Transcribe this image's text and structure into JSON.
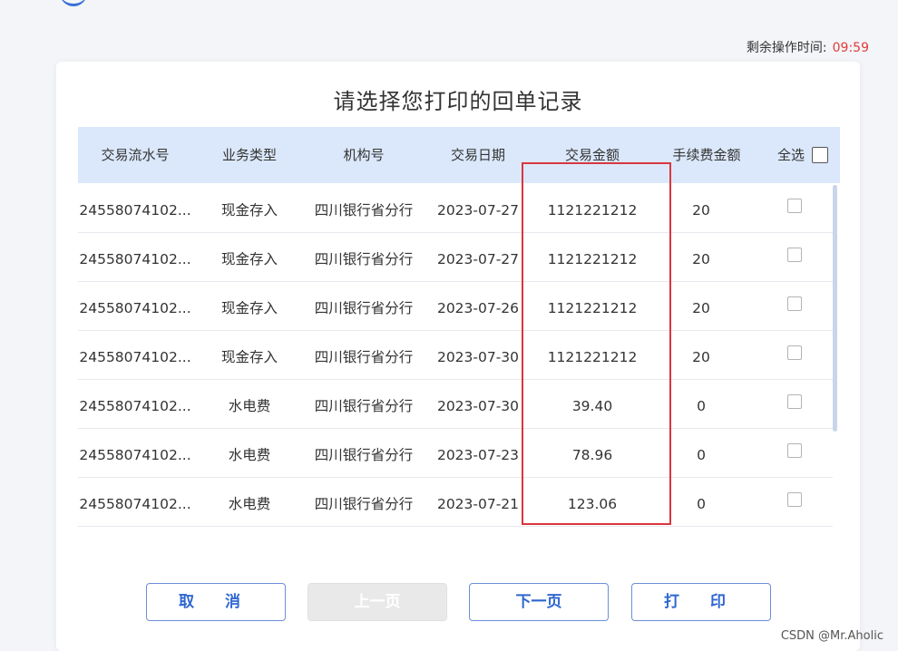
{
  "timer": {
    "label": "剩余操作时间:",
    "value": "09:59"
  },
  "title": "请选择您打印的回单记录",
  "table": {
    "headers": [
      "交易流水号",
      "业务类型",
      "机构号",
      "交易日期",
      "交易金额",
      "手续费金额",
      "全选"
    ],
    "rows": [
      [
        "24558074102...",
        "现金存入",
        "四川银行省分行",
        "2023-07-27",
        "1121221212",
        "20"
      ],
      [
        "24558074102...",
        "现金存入",
        "四川银行省分行",
        "2023-07-27",
        "1121221212",
        "20"
      ],
      [
        "24558074102...",
        "现金存入",
        "四川银行省分行",
        "2023-07-26",
        "1121221212",
        "20"
      ],
      [
        "24558074102...",
        "现金存入",
        "四川银行省分行",
        "2023-07-30",
        "1121221212",
        "20"
      ],
      [
        "24558074102...",
        "水电费",
        "四川银行省分行",
        "2023-07-30",
        "39.40",
        "0"
      ],
      [
        "24558074102...",
        "水电费",
        "四川银行省分行",
        "2023-07-23",
        "78.96",
        "0"
      ],
      [
        "24558074102...",
        "水电费",
        "四川银行省分行",
        "2023-07-21",
        "123.06",
        "0"
      ]
    ]
  },
  "buttons": {
    "cancel": "取 消",
    "prev": "上一页",
    "next": "下一页",
    "print": "打 印"
  },
  "watermark": "CSDN @Mr.Aholic",
  "colors": {
    "accent": "#2f67d0",
    "header_bg": "#dbe8fb",
    "timer_value": "#e23b3b",
    "highlight_box": "#d9363e"
  }
}
